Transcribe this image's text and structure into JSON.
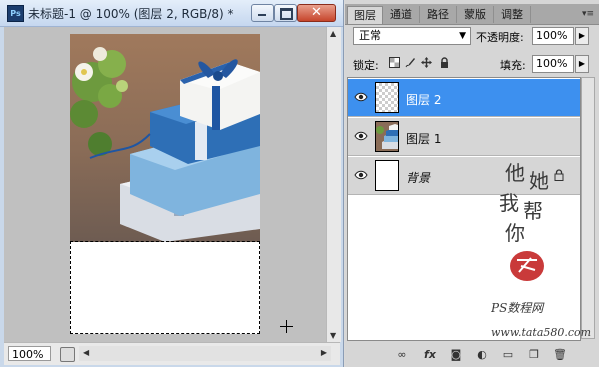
{
  "document": {
    "app_icon_label": "Ps",
    "title": "未标题-1 @ 100% (图层 2, RGB/8) *",
    "zoom": "100%"
  },
  "panel": {
    "tabs": [
      "图层",
      "通道",
      "路径",
      "蒙版",
      "调整"
    ],
    "active_tab": "图层",
    "blend_mode": "正常",
    "opacity_label": "不透明度:",
    "opacity": "100%",
    "lock_label": "锁定:",
    "fill_label": "填充:",
    "fill": "100%",
    "layers": [
      {
        "name": "图层 2",
        "selected": true,
        "visible": true
      },
      {
        "name": "图层 1",
        "selected": false,
        "visible": true
      },
      {
        "name": "背景",
        "selected": false,
        "visible": true,
        "locked": true
      }
    ],
    "watermark": {
      "chars": [
        "他",
        "她",
        "我",
        "帮",
        "你"
      ],
      "site_name": "PS数程网",
      "url": "www.tata580.com"
    }
  },
  "colors": {
    "selection_blue": "#3d90ef",
    "title_bar": "#c5d7ef",
    "close_red": "#c6452c"
  }
}
